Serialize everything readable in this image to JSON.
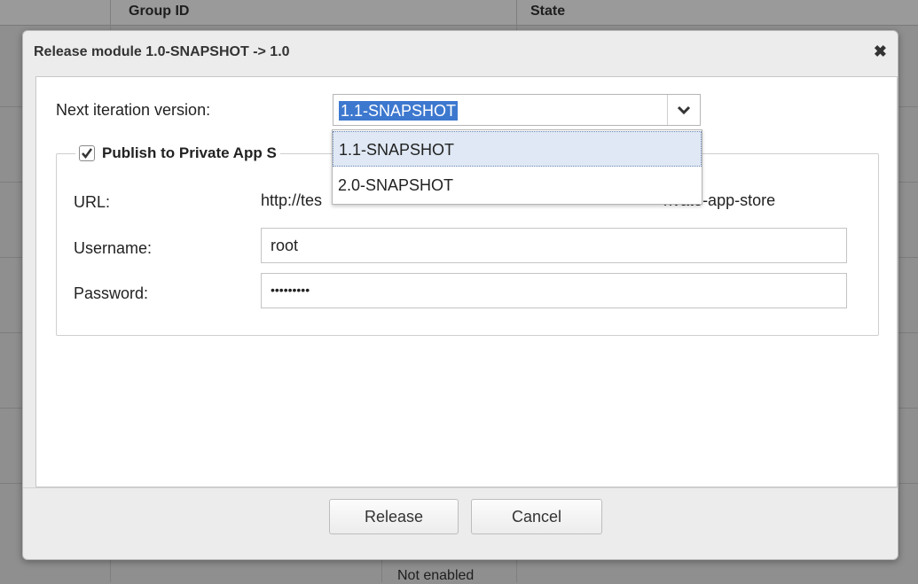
{
  "background": {
    "header_group_id": "Group ID",
    "header_state": "State",
    "cell_not_enabled": "Not enabled"
  },
  "dialog": {
    "title": "Release module 1.0-SNAPSHOT -> 1.0",
    "close_icon": "close-icon",
    "next_iteration_label": "Next iteration version:",
    "version_select": {
      "value": "1.1-SNAPSHOT",
      "options": [
        "1.1-SNAPSHOT",
        "2.0-SNAPSHOT"
      ],
      "arrow_icon": "chevron-down-icon"
    },
    "publish": {
      "checked": true,
      "legend": "Publish to Private App S",
      "url_label": "URL:",
      "url_value_start": "http://tes",
      "url_value_end": "rivate-app-store",
      "username_label": "Username:",
      "username_value": "root",
      "password_label": "Password:",
      "password_value": "•••••••••"
    },
    "buttons": {
      "release": "Release",
      "cancel": "Cancel"
    }
  }
}
